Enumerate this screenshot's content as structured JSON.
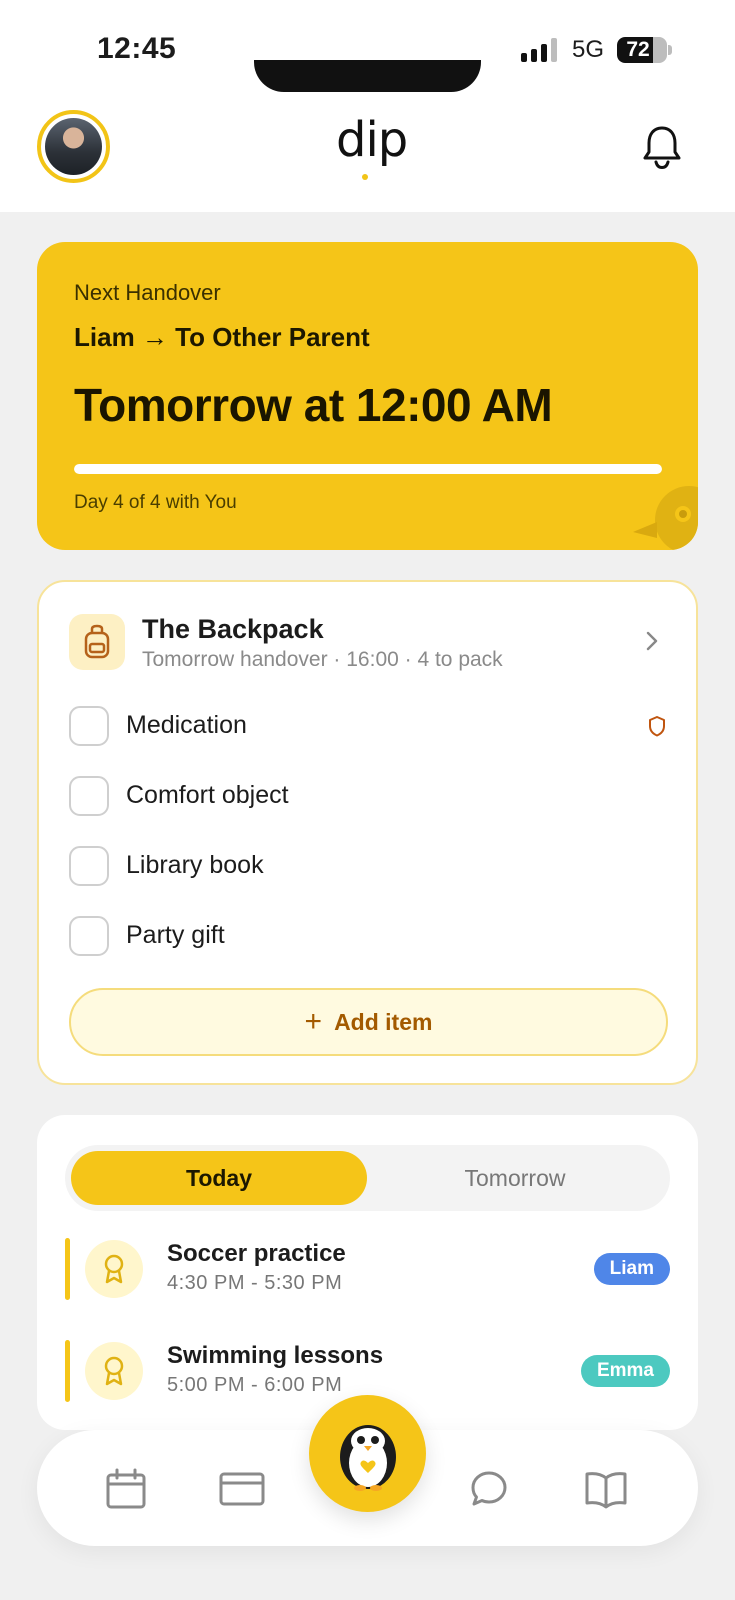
{
  "status_bar": {
    "time": "12:45",
    "network": "5G",
    "battery": "72",
    "battery_level": 0.72
  },
  "header": {
    "logo": "dip",
    "avatar_icon": "user-avatar",
    "notification_icon": "bell-icon"
  },
  "handover": {
    "label": "Next Handover",
    "route": "Liam → To Other Parent",
    "when": "Tomorrow at 12:00 AM",
    "progress": 1.0,
    "day_text": "Day 4 of 4 with You"
  },
  "backpack": {
    "title": "The Backpack",
    "subtitle": "Tomorrow handover · 16:00 · 4 to pack",
    "items": [
      {
        "label": "Medication",
        "checked": false,
        "flag_icon": "shield-icon"
      },
      {
        "label": "Comfort object",
        "checked": false
      },
      {
        "label": "Library book",
        "checked": false
      },
      {
        "label": "Party gift",
        "checked": false
      }
    ],
    "add_label": "Add item",
    "add_symbol": "+"
  },
  "schedule": {
    "tabs": [
      {
        "label": "Today",
        "active": true
      },
      {
        "label": "Tomorrow",
        "active": false
      }
    ],
    "events": [
      {
        "name": "Soccer practice",
        "time": "4:30 PM - 5:30 PM",
        "child": "Liam",
        "badge_color": "#4f86e8",
        "icon": "award-icon"
      },
      {
        "name": "Swimming lessons",
        "time": "5:00 PM - 6:00 PM",
        "child": "Emma",
        "badge_color": "#4cc9c0",
        "icon": "award-icon"
      }
    ]
  },
  "nav": {
    "items": [
      "calendar-icon",
      "card-icon",
      "penguin-home",
      "chat-icon",
      "book-icon"
    ]
  },
  "colors": {
    "accent": "#f5c518",
    "accent_text": "#a35a00"
  }
}
